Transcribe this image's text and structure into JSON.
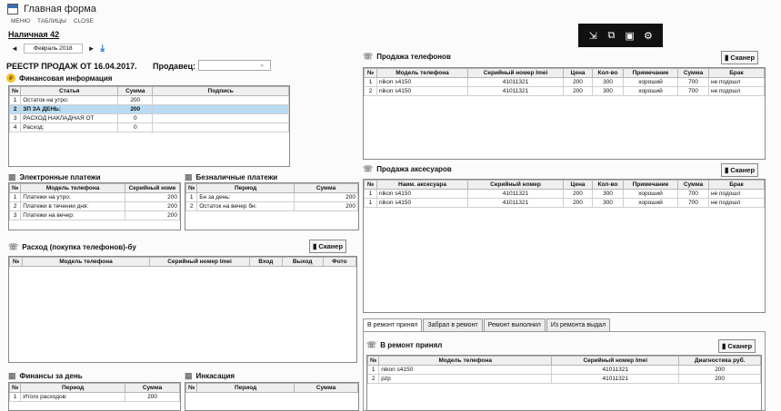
{
  "window": {
    "title": "Главная форма"
  },
  "menu": [
    "МЕНЮ",
    "ТАБЛИЦЫ",
    "CLOSE"
  ],
  "store": "Наличная 42",
  "date_nav": {
    "prev": "◄",
    "month": "Февраль 2018",
    "next": "►"
  },
  "registry": {
    "title": "РЕЕСТР ПРОДАЖ ОТ 16.04.2017.",
    "seller_label": "Продавец:",
    "seller_value": ""
  },
  "finance": {
    "title": "Финансовая информация",
    "headers": [
      "№",
      "Статья",
      "Сумма",
      "Подпись"
    ],
    "rows": [
      {
        "n": "1",
        "item": "Остаток на утро:",
        "sum": "200",
        "sign": ""
      },
      {
        "n": "2",
        "item": "ЗП ЗА ДЕНЬ:",
        "sum": "200",
        "sign": ""
      },
      {
        "n": "3",
        "item": "РАСХОД НАКЛАДНАЯ ОТ",
        "sum": "0",
        "sign": ""
      },
      {
        "n": "4",
        "item": "Расход:",
        "sum": "0",
        "sign": ""
      }
    ]
  },
  "electronic": {
    "title": "Электронные платежи",
    "headers": [
      "№",
      "Модель телефона",
      "Серийный номе"
    ],
    "rows": [
      {
        "n": "1",
        "model": "Платежи на утро:",
        "serial": "200"
      },
      {
        "n": "2",
        "model": "Платежи в течении дня:",
        "serial": "200"
      },
      {
        "n": "3",
        "model": "Платежи на вечер:",
        "serial": "200"
      }
    ]
  },
  "cashless": {
    "title": "Безналичные платежи",
    "headers": [
      "№",
      "Период",
      "Сумма"
    ],
    "rows": [
      {
        "n": "1",
        "period": "Бн за день:",
        "sum": "200"
      },
      {
        "n": "2",
        "period": "Остаток на вечер бн:",
        "sum": "200"
      }
    ]
  },
  "expense": {
    "title": "Расход (покупка телефонов)-бу",
    "scanner": "Сканер",
    "headers": [
      "№",
      "Модель телефона",
      "Серийный номер Imei",
      "Вход",
      "Выход",
      "Фото"
    ]
  },
  "day_finance": {
    "title": "Финансы за день",
    "headers": [
      "№",
      "Период",
      "Сумма"
    ],
    "rows": [
      {
        "n": "1",
        "period": "Итого расходов:",
        "sum": "200"
      }
    ]
  },
  "collection": {
    "title": "Инкасация",
    "headers": [
      "№",
      "Период",
      "Сумма"
    ]
  },
  "phone_sales": {
    "title": "Продажа телефонов",
    "scanner": "Сканер",
    "headers": [
      "№",
      "Модель телефона",
      "Серийный номер Imei",
      "Цена",
      "Кол-во",
      "Примечание",
      "Сумма",
      "Брак"
    ],
    "rows": [
      {
        "n": "1",
        "model": "nikon s4150",
        "serial": "41011321",
        "price": "200",
        "qty": "300",
        "note": "хороший",
        "sum": "700",
        "defect": "не подошл"
      },
      {
        "n": "2",
        "model": "nikon s4150",
        "serial": "41011321",
        "price": "200",
        "qty": "300",
        "note": "хороший",
        "sum": "700",
        "defect": "не подошл"
      }
    ]
  },
  "accessory_sales": {
    "title": "Продажа аксесуаров",
    "scanner": "Сканер",
    "headers": [
      "№",
      "Наим. аксесуара",
      "Серийный номер",
      "Цена",
      "Кол-во",
      "Примечание",
      "Сумма",
      "Брак"
    ],
    "rows": [
      {
        "n": "1",
        "model": "nikon s4150",
        "serial": "41011321",
        "price": "200",
        "qty": "300",
        "note": "хороший",
        "sum": "700",
        "defect": "не подошл"
      },
      {
        "n": "1",
        "model": "nikon s4150",
        "serial": "41011321",
        "price": "200",
        "qty": "300",
        "note": "хороший",
        "sum": "700",
        "defect": "не подошл"
      }
    ]
  },
  "repair_tabs": [
    "В ремонт принял",
    "Забрал в ремонт",
    "Ремонт выполнил",
    "Из ремонта выдал"
  ],
  "repair": {
    "title": "В ремонт принял",
    "scanner": "Сканер",
    "headers": [
      "№",
      "Модель телефона",
      "Серийный номер Imei",
      "Диагностика руб."
    ],
    "rows": [
      {
        "n": "1",
        "model": "nikon s4150",
        "serial": "41011321",
        "diag": "200"
      },
      {
        "n": "2",
        "model": "pzp",
        "serial": "41011321",
        "diag": "200"
      }
    ]
  }
}
